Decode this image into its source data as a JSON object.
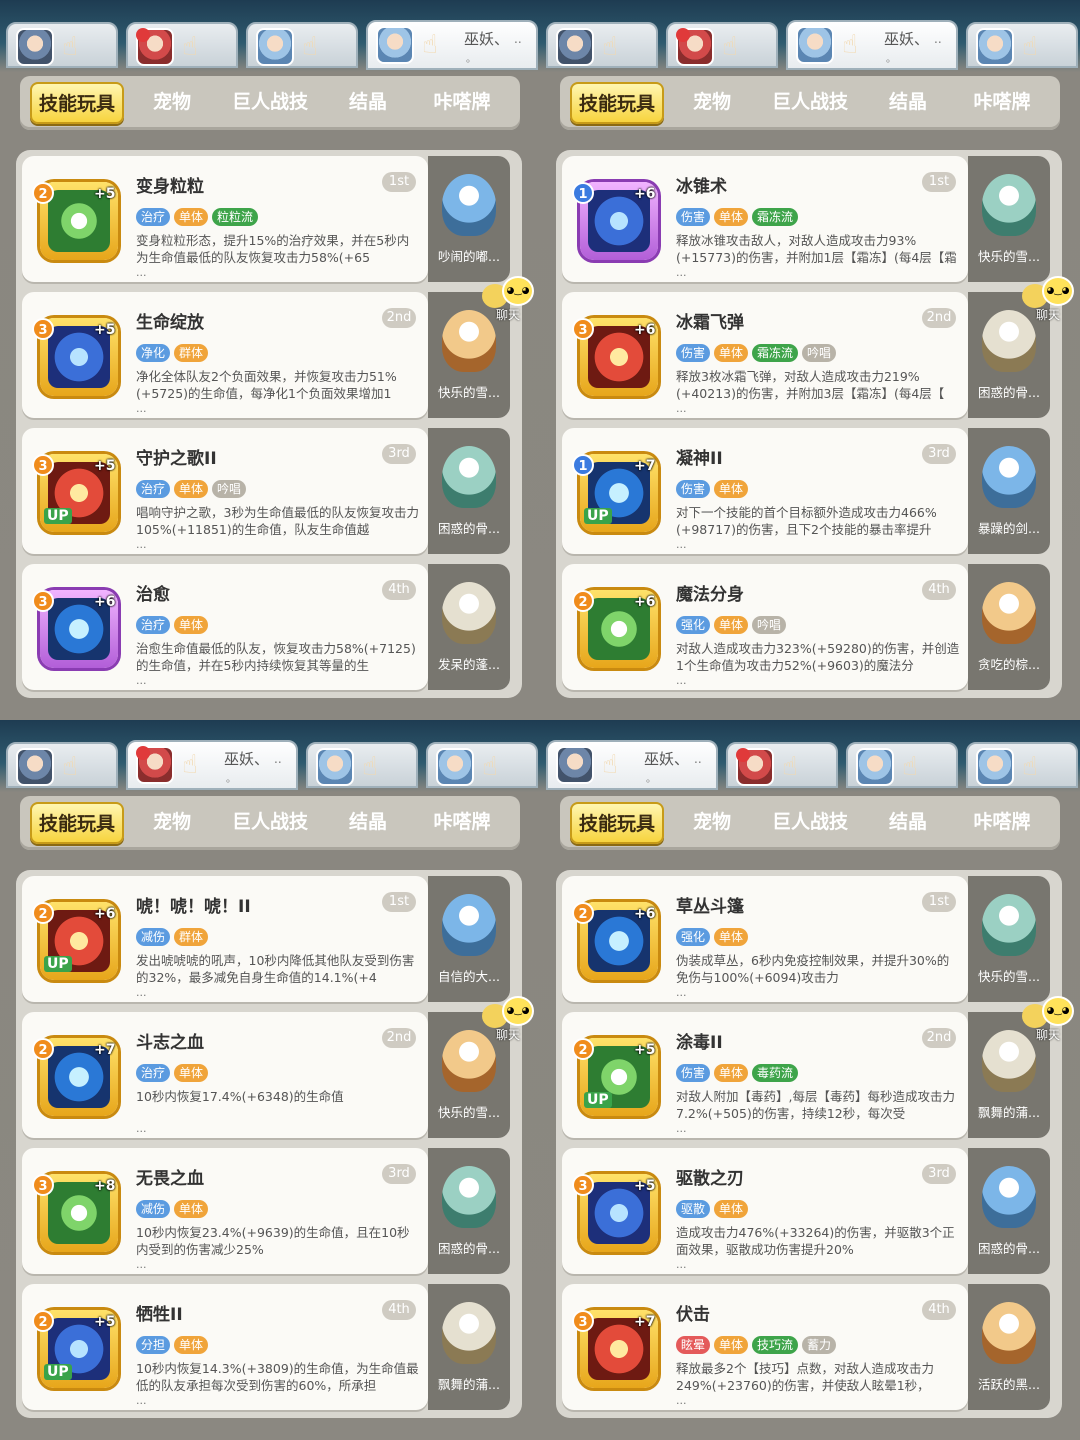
{
  "colors": {
    "heal": "#5b9be0",
    "single": "#f0a43a",
    "group": "#f0a43a",
    "green": "#3ea44a",
    "gray": "#b8b3a8",
    "purple": "#9a6fd0",
    "red": "#e45a5a",
    "accent": "#f7d43e"
  },
  "nav": [
    "技能玩具",
    "宠物",
    "巨人战技",
    "结晶",
    "咔嗒牌"
  ],
  "chat_label": "聊天",
  "panels": [
    {
      "name": "巫妖、",
      "dots": "..",
      "dot": "。",
      "active_tab": 3,
      "cards": [
        {
          "name": "变身粒粒",
          "rank": "1st",
          "level": "2",
          "plus": "+5",
          "up": false,
          "frame": "gold",
          "tags": [
            {
              "t": "治疗",
              "c": "heal"
            },
            {
              "t": "单体",
              "c": "single"
            },
            {
              "t": "粒粒流",
              "c": "green"
            }
          ],
          "desc": "变身粒粒形态，提升15%的治疗效果，并在5秒内为生命值最低的队友恢复攻击力58%(+65",
          "pet": "吵闹的嘟..."
        },
        {
          "name": "生命绽放",
          "rank": "2nd",
          "level": "3",
          "plus": "+5",
          "up": false,
          "frame": "gold",
          "tags": [
            {
              "t": "净化",
              "c": "heal"
            },
            {
              "t": "群体",
              "c": "group"
            }
          ],
          "desc": "净化全体队友2个负面效果，并恢复攻击力51%(+5725)的生命值，每净化1个负面效果增加1",
          "pet": "快乐的雪..."
        },
        {
          "name": "守护之歌II",
          "rank": "3rd",
          "level": "3",
          "plus": "+5",
          "up": true,
          "frame": "gold",
          "tags": [
            {
              "t": "治疗",
              "c": "heal"
            },
            {
              "t": "单体",
              "c": "single"
            },
            {
              "t": "吟唱",
              "c": "gray"
            }
          ],
          "desc": "唱响守护之歌，3秒为生命值最低的队友恢复攻击力105%(+11851)的生命值，队友生命值越",
          "pet": "困惑的骨..."
        },
        {
          "name": "治愈",
          "rank": "4th",
          "level": "3",
          "plus": "+6",
          "up": false,
          "frame": "purple",
          "tags": [
            {
              "t": "治疗",
              "c": "heal"
            },
            {
              "t": "单体",
              "c": "single"
            }
          ],
          "desc": "治愈生命值最低的队友，恢复攻击力58%(+7125)的生命值，并在5秒内持续恢复其等量的生",
          "pet": "发呆的蓬..."
        }
      ]
    },
    {
      "name": "巫妖、",
      "dots": "..",
      "dot": "。",
      "active_tab": 2,
      "cards": [
        {
          "name": "冰锥术",
          "rank": "1st",
          "level": "1",
          "plus": "+6",
          "up": false,
          "frame": "purple",
          "tags": [
            {
              "t": "伤害",
              "c": "heal"
            },
            {
              "t": "单体",
              "c": "single"
            },
            {
              "t": "霜冻流",
              "c": "green"
            }
          ],
          "desc": "释放冰锥攻击敌人，对敌人造成攻击力93%(+15773)的伤害，并附加1层【霜冻】(每4层【霜",
          "pet": "快乐的雪..."
        },
        {
          "name": "冰霜飞弹",
          "rank": "2nd",
          "level": "3",
          "plus": "+6",
          "up": false,
          "frame": "gold",
          "tags": [
            {
              "t": "伤害",
              "c": "heal"
            },
            {
              "t": "单体",
              "c": "single"
            },
            {
              "t": "霜冻流",
              "c": "green"
            },
            {
              "t": "吟唱",
              "c": "gray"
            }
          ],
          "desc": "释放3枚冰霜飞弹，对敌人造成攻击力219%(+40213)的伤害，并附加3层【霜冻】(每4层【",
          "pet": "困惑的骨..."
        },
        {
          "name": "凝神II",
          "rank": "3rd",
          "level": "1",
          "plus": "+7",
          "up": true,
          "frame": "gold",
          "tags": [
            {
              "t": "伤害",
              "c": "heal"
            },
            {
              "t": "单体",
              "c": "single"
            }
          ],
          "desc": "对下一个技能的首个目标额外造成攻击力466%(+98717)的伤害，且下2个技能的暴击率提升",
          "pet": "暴躁的剑..."
        },
        {
          "name": "魔法分身",
          "rank": "4th",
          "level": "2",
          "plus": "+6",
          "up": false,
          "frame": "gold",
          "tags": [
            {
              "t": "强化",
              "c": "heal"
            },
            {
              "t": "单体",
              "c": "single"
            },
            {
              "t": "吟唱",
              "c": "gray"
            }
          ],
          "desc": "对敌人造成攻击力323%(+59280)的伤害，并创造1个生命值为攻击力52%(+9603)的魔法分",
          "pet": "贪吃的棕..."
        }
      ]
    },
    {
      "name": "巫妖、",
      "dots": "..",
      "dot": "。",
      "active_tab": 1,
      "cards": [
        {
          "name": "唬！唬！唬！II",
          "rank": "1st",
          "level": "2",
          "plus": "+6",
          "up": true,
          "frame": "gold",
          "tags": [
            {
              "t": "减伤",
              "c": "heal"
            },
            {
              "t": "群体",
              "c": "group"
            }
          ],
          "desc": "发出唬唬唬的吼声，10秒内降低其他队友受到伤害的32%，最多减免自身生命值的14.1%(+4",
          "pet": "自信的大..."
        },
        {
          "name": "斗志之血",
          "rank": "2nd",
          "level": "2",
          "plus": "+7",
          "up": false,
          "frame": "gold",
          "tags": [
            {
              "t": "治疗",
              "c": "heal"
            },
            {
              "t": "单体",
              "c": "single"
            }
          ],
          "desc": "10秒内恢复17.4%(+6348)的生命值",
          "pet": "快乐的雪..."
        },
        {
          "name": "无畏之血",
          "rank": "3rd",
          "level": "3",
          "plus": "+8",
          "up": false,
          "frame": "gold",
          "tags": [
            {
              "t": "减伤",
              "c": "heal"
            },
            {
              "t": "单体",
              "c": "single"
            }
          ],
          "desc": "10秒内恢复23.4%(+9639)的生命值，且在10秒内受到的伤害减少25%",
          "pet": "困惑的骨..."
        },
        {
          "name": "牺牲II",
          "rank": "4th",
          "level": "2",
          "plus": "+5",
          "up": true,
          "frame": "gold",
          "tags": [
            {
              "t": "分担",
              "c": "heal"
            },
            {
              "t": "单体",
              "c": "single"
            }
          ],
          "desc": "10秒内恢复14.3%(+3809)的生命值，为生命值最低的队友承担每次受到伤害的60%，所承担",
          "pet": "飘舞的蒲..."
        }
      ]
    },
    {
      "name": "巫妖、",
      "dots": "..",
      "dot": "。",
      "active_tab": 0,
      "cards": [
        {
          "name": "草丛斗篷",
          "rank": "1st",
          "level": "2",
          "plus": "+6",
          "up": false,
          "frame": "gold",
          "tags": [
            {
              "t": "强化",
              "c": "heal"
            },
            {
              "t": "单体",
              "c": "single"
            }
          ],
          "desc": "伪装成草丛，6秒内免疫控制效果，并提升30%的免伤与100%(+6094)攻击力",
          "pet": "快乐的雪..."
        },
        {
          "name": "涂毒II",
          "rank": "2nd",
          "level": "2",
          "plus": "+5",
          "up": true,
          "frame": "gold",
          "tags": [
            {
              "t": "伤害",
              "c": "heal"
            },
            {
              "t": "单体",
              "c": "single"
            },
            {
              "t": "毒药流",
              "c": "green"
            }
          ],
          "desc": "对敌人附加【毒药】,每层【毒药】每秒造成攻击力7.2%(+505)的伤害，持续12秒，每次受",
          "pet": "飘舞的蒲..."
        },
        {
          "name": "驱散之刃",
          "rank": "3rd",
          "level": "3",
          "plus": "+5",
          "up": false,
          "frame": "gold",
          "tags": [
            {
              "t": "驱散",
              "c": "heal"
            },
            {
              "t": "单体",
              "c": "single"
            }
          ],
          "desc": "造成攻击力476%(+33264)的伤害，并驱散3个正面效果，驱散成功伤害提升20%",
          "pet": "困惑的骨..."
        },
        {
          "name": "伏击",
          "rank": "4th",
          "level": "3",
          "plus": "+7",
          "up": false,
          "frame": "gold",
          "tags": [
            {
              "t": "眩晕",
              "c": "red"
            },
            {
              "t": "单体",
              "c": "single"
            },
            {
              "t": "技巧流",
              "c": "green"
            },
            {
              "t": "蓄力",
              "c": "gray"
            }
          ],
          "desc": "释放最多2个【技巧】点数，对敌人造成攻击力249%(+23760)的伤害，并使敌人眩晕1秒，",
          "pet": "活跃的黑..."
        }
      ]
    }
  ]
}
